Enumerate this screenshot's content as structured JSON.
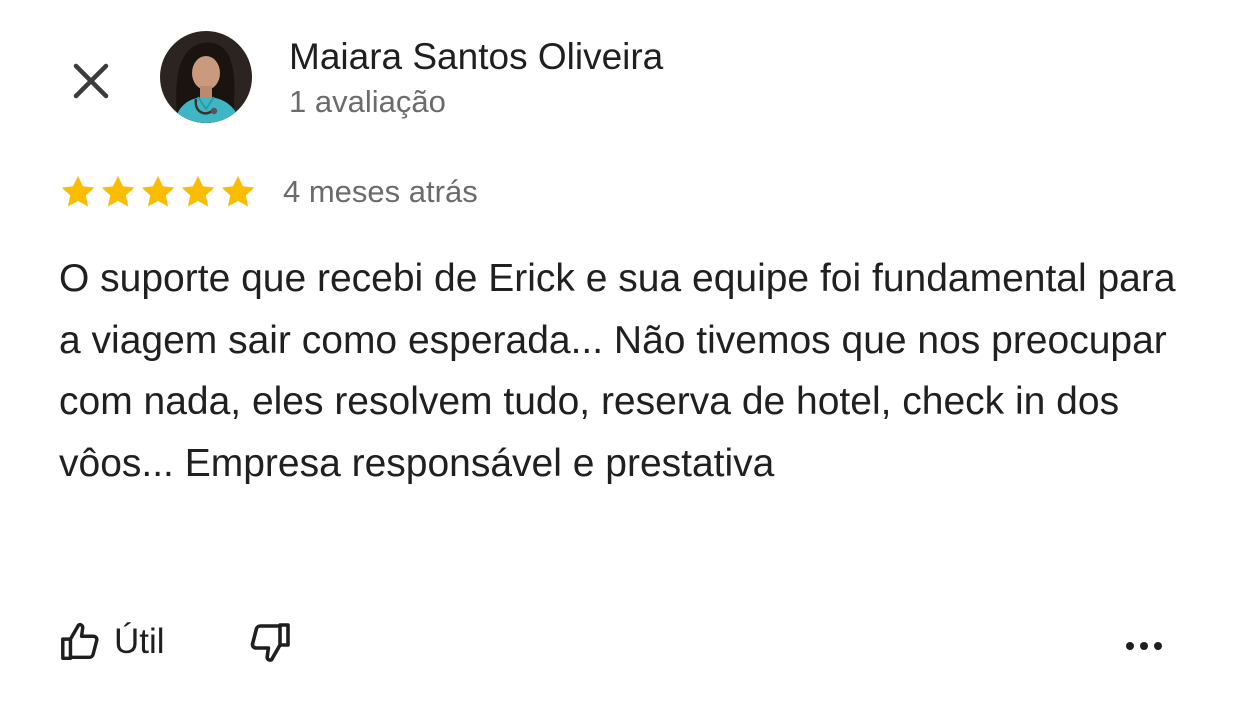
{
  "reviewer": {
    "name": "Maiara Santos Oliveira",
    "meta": "1 avaliação",
    "avatar_icon": "profile-photo"
  },
  "review": {
    "rating": 5,
    "rating_max": 5,
    "date": "4 meses atrás",
    "text": "O suporte que recebi de Erick e sua equipe foi fundamental para a viagem sair como esperada... Não tivemos que nos preocupar com nada, eles resolvem tudo, reserva de hotel, check in dos vôos... Empresa responsável e prestativa"
  },
  "actions": {
    "useful_label": "Útil",
    "useful_icon": "thumbs-up-icon",
    "dislike_icon": "thumbs-down-icon",
    "more_icon": "more-horiz-icon",
    "close_icon": "close-icon"
  },
  "colors": {
    "star": "#fbbc04",
    "text": "#1f1f1f",
    "secondary_text": "#6b6b6b"
  }
}
